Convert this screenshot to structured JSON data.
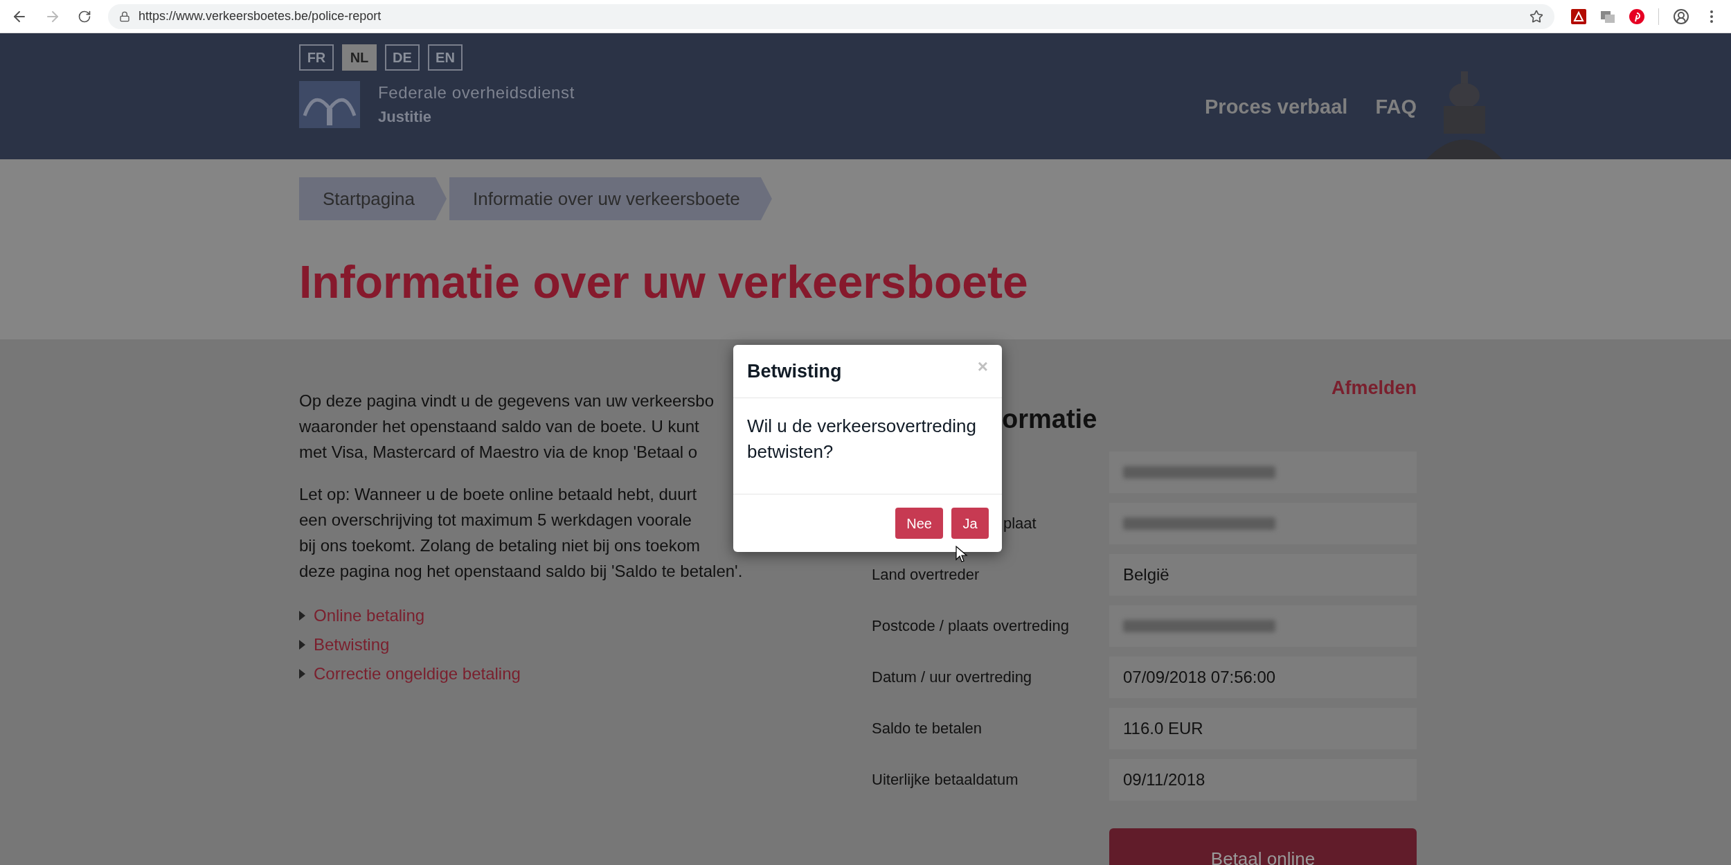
{
  "browser": {
    "url": "https://www.verkeersboetes.be/police-report",
    "back_enabled": true,
    "forward_enabled": false
  },
  "header": {
    "languages": [
      {
        "label": "FR",
        "selected": false
      },
      {
        "label": "NL",
        "selected": true
      },
      {
        "label": "DE",
        "selected": false
      },
      {
        "label": "EN",
        "selected": false
      }
    ],
    "org_line1": "Federale overheidsdienst",
    "org_line2": "Justitie",
    "nav": [
      "Proces verbaal",
      "FAQ"
    ]
  },
  "breadcrumb": [
    "Startpagina",
    "Informatie over uw verkeersboete"
  ],
  "page_title": "Informatie over uw verkeersboete",
  "intro": [
    [
      "Op deze pagina vindt u de gegevens van uw verkeersbo",
      "waaronder het openstaand saldo van de boete. U kunt",
      "met Visa, Mastercard of Maestro via de knop 'Betaal o"
    ],
    [
      "Let op: Wanneer u de boete online betaald hebt, duurt",
      "een overschrijving tot maximum 5 werkdagen voorale",
      "bij ons toekomt. Zolang de betaling niet bij ons toekom",
      "deze pagina nog het openstaand saldo bij 'Saldo te betalen'."
    ]
  ],
  "links": [
    "Online betaling",
    "Betwisting",
    "Correctie ongeldige betaling"
  ],
  "info": {
    "logout": "Afmelden",
    "heading": "ormatie",
    "rows": [
      {
        "redacted": true
      },
      {
        "label": "plaat",
        "redacted": true
      },
      {
        "label": "Land overtreder",
        "value": "België",
        "redacted": false
      },
      {
        "label": "Postcode / plaats overtreding",
        "redacted": true
      },
      {
        "label": "Datum / uur overtreding",
        "value": "07/09/2018 07:56:00",
        "redacted": false
      },
      {
        "label": "Saldo te betalen",
        "value": "116.0 EUR",
        "redacted": false
      },
      {
        "label": "Uiterlijke betaaldatum",
        "value": "09/11/2018",
        "redacted": false
      }
    ],
    "pay_button": "Betaal online"
  },
  "dialog": {
    "title": "Betwisting",
    "close": "×",
    "message": "Wil u de verkeersovertreding betwisten?",
    "buttons": [
      "Nee",
      "Ja"
    ]
  }
}
